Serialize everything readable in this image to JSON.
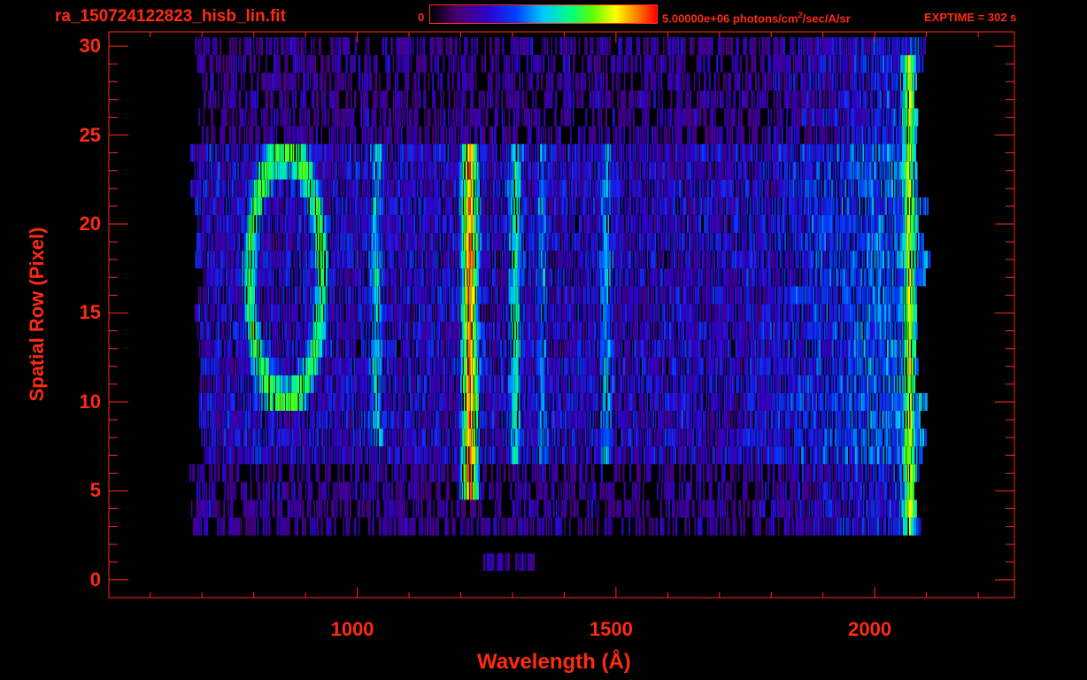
{
  "header": {
    "filename": "ra_150724122823_hisb_lin.fit",
    "colorbar_min": "0",
    "colorbar_max_prefix": "5.00000e+06 photons/cm",
    "colorbar_max_sup": "2",
    "colorbar_max_suffix": "/sec/A/sr",
    "exptime": "EXPTIME = 302 s"
  },
  "colors": {
    "axis": "#ff2a12",
    "background": "#000000",
    "colormap": [
      "#000000",
      "#4a0070",
      "#3000c8",
      "#0040ff",
      "#00c8ff",
      "#00ff80",
      "#60ff00",
      "#ffff00",
      "#ff8000",
      "#ff0000"
    ]
  },
  "chart_data": {
    "type": "heatmap",
    "xlabel": "Wavelength (Å)",
    "ylabel": "Spatial Row (Pixel)",
    "xlim": [
      520,
      2270
    ],
    "ylim": [
      -1,
      30.8
    ],
    "x_ticks": [
      1000,
      1500,
      2000
    ],
    "y_ticks": [
      0,
      5,
      10,
      15,
      20,
      25,
      30
    ],
    "colorbar_range": [
      0,
      5000000
    ],
    "colorbar_unit": "photons/cm^2/sec/A/sr",
    "features": [
      {
        "label": "bright emission line",
        "x": 1216,
        "rows": [
          5,
          24
        ],
        "intensity": 0.92
      },
      {
        "label": "emission line",
        "x": 1304,
        "rows": [
          7,
          24
        ],
        "intensity": 0.55
      },
      {
        "label": "emission line",
        "x": 1035,
        "rows": [
          8,
          24
        ],
        "intensity": 0.5
      },
      {
        "label": "emission line",
        "x": 1480,
        "rows": [
          7,
          24
        ],
        "intensity": 0.45
      },
      {
        "label": "emission line",
        "x": 1356,
        "rows": [
          7,
          24
        ],
        "intensity": 0.4
      },
      {
        "label": "ring structure",
        "x": 860,
        "rows": [
          10,
          24
        ],
        "intensity": 0.6
      },
      {
        "label": "red edge",
        "x": 2065,
        "rows": [
          2,
          29
        ],
        "intensity": 0.75
      }
    ],
    "detector_coverage": {
      "x": [
        690,
        2090
      ],
      "rows": [
        3,
        30
      ]
    }
  }
}
